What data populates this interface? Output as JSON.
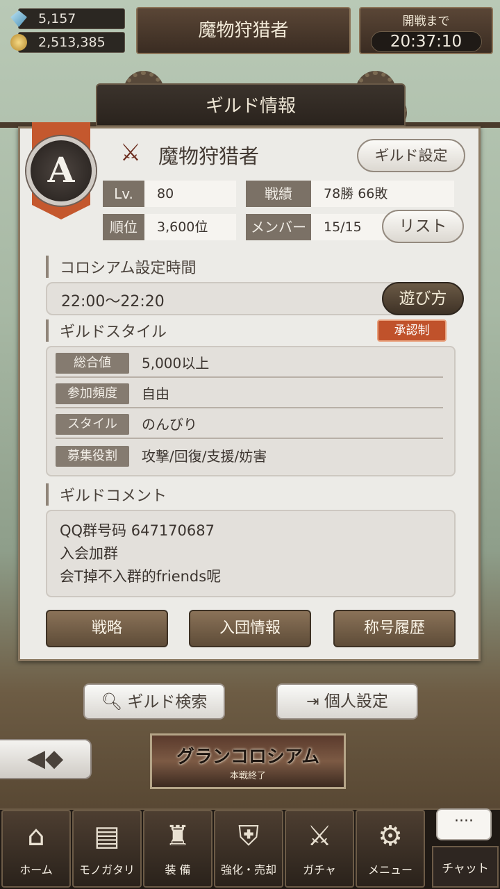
{
  "currency": {
    "gems": "5,157",
    "coins": "2,513,385"
  },
  "header": {
    "title": "魔物狩猎者",
    "timer_label": "開戦まで",
    "timer_value": "20:37:10"
  },
  "panel": {
    "title": "ギルド情報",
    "rank": "A",
    "guild_name": "魔物狩猎者",
    "settings_button": "ギルド設定",
    "stats": {
      "level_label": "Lv.",
      "level_value": "80",
      "record_label": "戦績",
      "record_value": "78勝  66敗",
      "rank_label": "順位",
      "rank_value": "3,600位",
      "member_label": "メンバー",
      "member_value": "15/15"
    },
    "list_button": "リスト",
    "colosseum_title": "コロシアム設定時間",
    "colosseum_time": "22:00〜22:20",
    "howto_button": "遊び方",
    "style_title": "ギルドスタイル",
    "approval_badge": "承認制",
    "style_rows": [
      {
        "label": "総合値",
        "value": "5,000以上"
      },
      {
        "label": "参加頻度",
        "value": "自由"
      },
      {
        "label": "スタイル",
        "value": "のんびり"
      },
      {
        "label": "募集役割",
        "value": "攻撃/回復/支援/妨害"
      }
    ],
    "comment_title": "ギルドコメント",
    "comment_lines": [
      "QQ群号码 647170687",
      "入会加群",
      "会T掉不入群的friends呢"
    ],
    "buttons": {
      "strategy": "戦略",
      "join_info": "入団情報",
      "title_history": "称号履歴"
    }
  },
  "actions": {
    "guild_search": "ギルド検索",
    "personal_settings": "個人設定"
  },
  "banner": {
    "title": "グランコロシアム",
    "subtitle": "本戦終了"
  },
  "nav": [
    {
      "label": "ホーム",
      "icon": "home-icon"
    },
    {
      "label": "モノガタリ",
      "icon": "book-icon"
    },
    {
      "label": "装 備",
      "icon": "equipment-icon"
    },
    {
      "label": "強化・売却",
      "icon": "enhance-icon"
    },
    {
      "label": "ガチャ",
      "icon": "gacha-icon"
    },
    {
      "label": "メニュー",
      "icon": "menu-icon"
    }
  ],
  "chat": {
    "label": "チャット",
    "bubble": "····"
  },
  "colors": {
    "accent_orange": "#c4582e",
    "panel_bg": "#ecebe7",
    "dark_brown": "#3e3226"
  }
}
